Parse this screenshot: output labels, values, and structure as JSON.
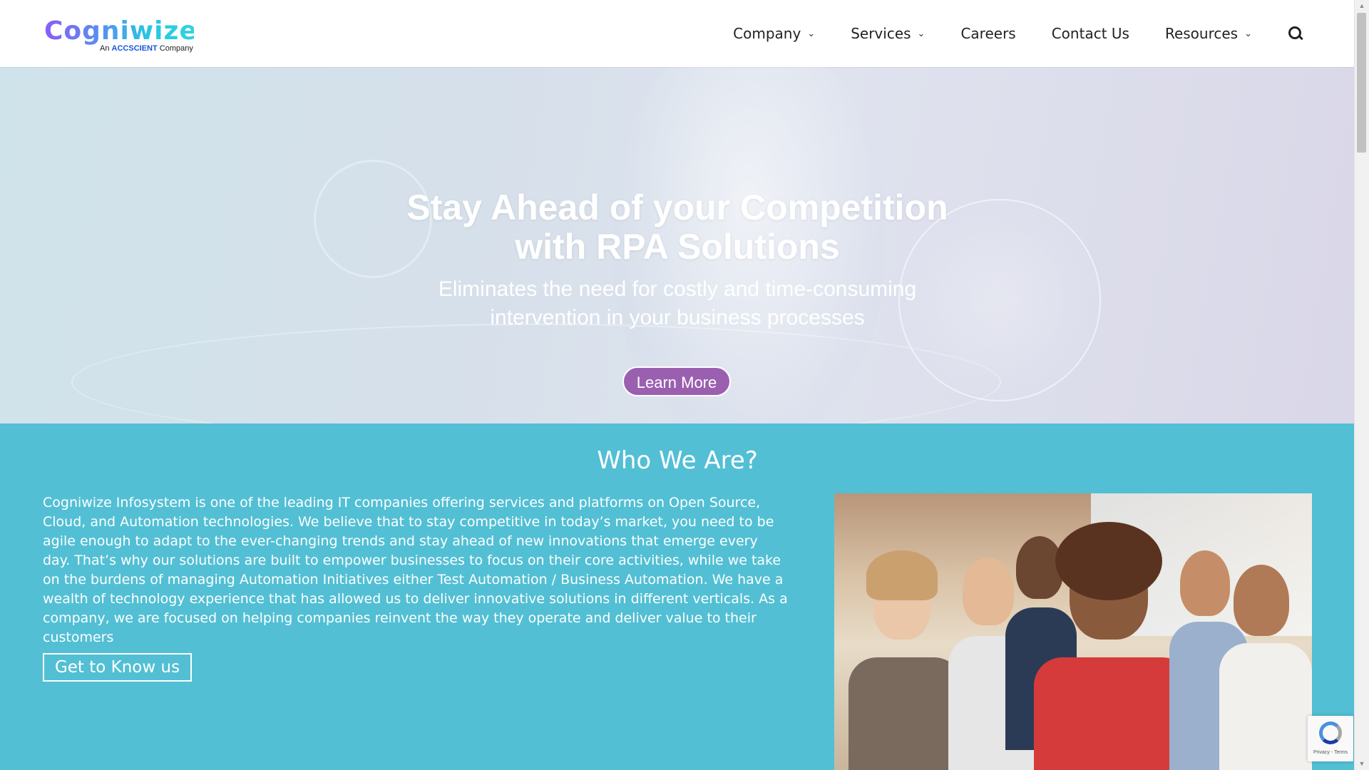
{
  "logo": {
    "name": "Cogniwize",
    "tagline_prefix": "An",
    "tagline_brand": "ACCSCIENT",
    "tagline_suffix": "Company"
  },
  "nav": {
    "items": [
      {
        "label": "Company",
        "dropdown": true
      },
      {
        "label": "Services",
        "dropdown": true
      },
      {
        "label": "Careers",
        "dropdown": false
      },
      {
        "label": "Contact Us",
        "dropdown": false
      },
      {
        "label": "Resources",
        "dropdown": true
      }
    ],
    "chevron": "⌄"
  },
  "hero": {
    "title_line1": "Stay Ahead of your Competition",
    "title_line2": "with RPA Solutions",
    "subtitle_line1": "Eliminates the need for costly and time-consuming",
    "subtitle_line2": "intervention in your business processes",
    "button": "Learn More"
  },
  "who": {
    "title": "Who We Are?",
    "body": "Cogniwize Infosystem is one of the leading IT companies offering services and platforms on Open Source, Cloud, and Automation technologies. We believe that to stay competitive in today’s market, you need to be agile enough to adapt to the ever-changing trends and stay ahead of new innovations that emerge every day. That’s why our solutions are built to empower businesses to focus on their core activities, while we take on the burdens of managing Automation Initiatives either Test Automation / Business Automation. We have a wealth of technology experience that has allowed us to deliver innovative solutions in different verticals. As a company, we are focused on helping companies reinvent the way they operate and deliver value to their customers",
    "button": "Get to Know us"
  },
  "recaptcha": {
    "text": "Privacy - Terms"
  },
  "colors": {
    "accent_purple": "#9b5fb0",
    "section_teal": "#52bfd4",
    "nav_text": "#222222"
  }
}
